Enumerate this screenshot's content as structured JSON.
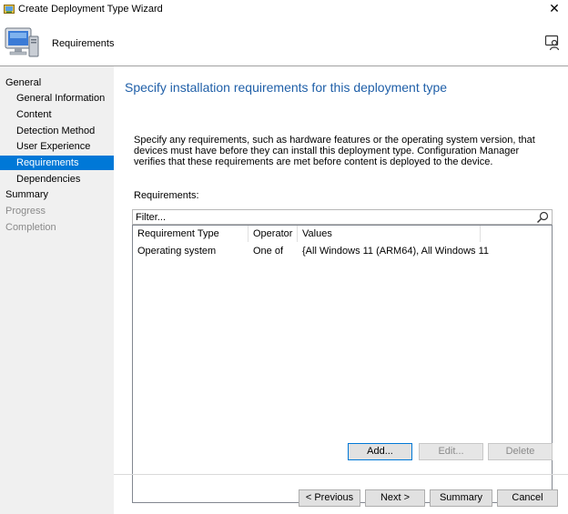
{
  "window": {
    "title": "Create Deployment Type Wizard",
    "close_glyph": "✕",
    "app_icon": "wizard-app-icon"
  },
  "header": {
    "page_name": "Requirements",
    "big_icon": "computer-monitor-icon",
    "help_icon": "help-person-icon"
  },
  "sidebar": {
    "items": [
      {
        "label": "General",
        "level": "top",
        "state": "normal"
      },
      {
        "label": "General Information",
        "level": "sub",
        "state": "normal"
      },
      {
        "label": "Content",
        "level": "sub",
        "state": "normal"
      },
      {
        "label": "Detection Method",
        "level": "sub",
        "state": "normal"
      },
      {
        "label": "User Experience",
        "level": "sub",
        "state": "normal"
      },
      {
        "label": "Requirements",
        "level": "sub",
        "state": "selected"
      },
      {
        "label": "Dependencies",
        "level": "sub",
        "state": "normal"
      },
      {
        "label": "Summary",
        "level": "top",
        "state": "normal"
      },
      {
        "label": "Progress",
        "level": "top",
        "state": "disabled"
      },
      {
        "label": "Completion",
        "level": "top",
        "state": "disabled"
      }
    ]
  },
  "main": {
    "heading": "Specify installation requirements for this deployment type",
    "description": "Specify any requirements, such as hardware features or the operating system version, that devices must have before they can install this deployment type. Configuration Manager verifies that these requirements are met before content is deployed to the device.",
    "requirements_label": "Requirements:",
    "filter_text": "Filter...",
    "columns": [
      "Requirement Type",
      "Operator",
      "Values"
    ],
    "rows": [
      [
        "Operating system",
        "One of",
        "{All Windows 11 (ARM64), All Windows 11 ..."
      ]
    ]
  },
  "actions": {
    "add": "Add...",
    "edit": "Edit...",
    "delete": "Delete"
  },
  "nav": {
    "previous": "< Previous",
    "next": "Next >",
    "summary": "Summary",
    "cancel": "Cancel"
  },
  "colors": {
    "accent": "#0078d7",
    "heading": "#1f5fa8",
    "sidebar_bg": "#f0f0f0"
  }
}
